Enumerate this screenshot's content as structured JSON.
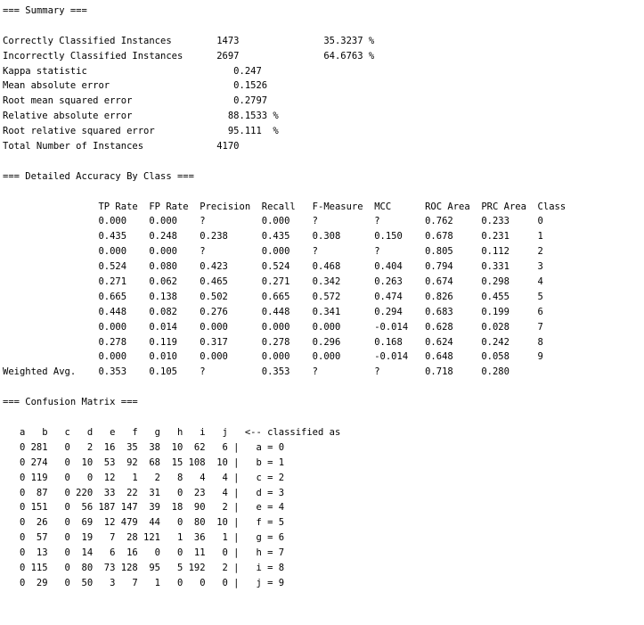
{
  "summary": {
    "heading": "=== Summary ===",
    "lines": [
      "Correctly Classified Instances        1473               35.3237 %",
      "Incorrectly Classified Instances      2697               64.6763 %",
      "Kappa statistic                          0.247",
      "Mean absolute error                      0.1526",
      "Root mean squared error                  0.2797",
      "Relative absolute error                 88.1533 %",
      "Root relative squared error             95.111  %",
      "Total Number of Instances             4170"
    ]
  },
  "detailed_accuracy": {
    "heading": "=== Detailed Accuracy By Class ===",
    "header": "                 TP Rate  FP Rate  Precision  Recall   F-Measure  MCC      ROC Area  PRC Area  Class",
    "rows": [
      "                 0.000    0.000    ?          0.000    ?          ?        0.762     0.233     0",
      "                 0.435    0.248    0.238      0.435    0.308      0.150    0.678     0.231     1",
      "                 0.000    0.000    ?          0.000    ?          ?        0.805     0.112     2",
      "                 0.524    0.080    0.423      0.524    0.468      0.404    0.794     0.331     3",
      "                 0.271    0.062    0.465      0.271    0.342      0.263    0.674     0.298     4",
      "                 0.665    0.138    0.502      0.665    0.572      0.474    0.826     0.455     5",
      "                 0.448    0.082    0.276      0.448    0.341      0.294    0.683     0.199     6",
      "                 0.000    0.014    0.000      0.000    0.000      -0.014   0.628     0.028     7",
      "                 0.278    0.119    0.317      0.278    0.296      0.168    0.624     0.242     8",
      "                 0.000    0.010    0.000      0.000    0.000      -0.014   0.648     0.058     9",
      "Weighted Avg.    0.353    0.105    ?          0.353    ?          ?        0.718     0.280"
    ]
  },
  "confusion_matrix": {
    "heading": "=== Confusion Matrix ===",
    "header": "   a   b   c   d   e   f   g   h   i   j   <-- classified as",
    "rows": [
      "   0 281   0   2  16  35  38  10  62   6 |   a = 0",
      "   0 274   0  10  53  92  68  15 108  10 |   b = 1",
      "   0 119   0   0  12   1   2   8   4   4 |   c = 2",
      "   0  87   0 220  33  22  31   0  23   4 |   d = 3",
      "   0 151   0  56 187 147  39  18  90   2 |   e = 4",
      "   0  26   0  69  12 479  44   0  80  10 |   f = 5",
      "   0  57   0  19   7  28 121   1  36   1 |   g = 6",
      "   0  13   0  14   6  16   0   0  11   0 |   h = 7",
      "   0 115   0  80  73 128  95   5 192   2 |   i = 8",
      "   0  29   0  50   3   7   1   0   0   0 |   j = 9"
    ]
  }
}
